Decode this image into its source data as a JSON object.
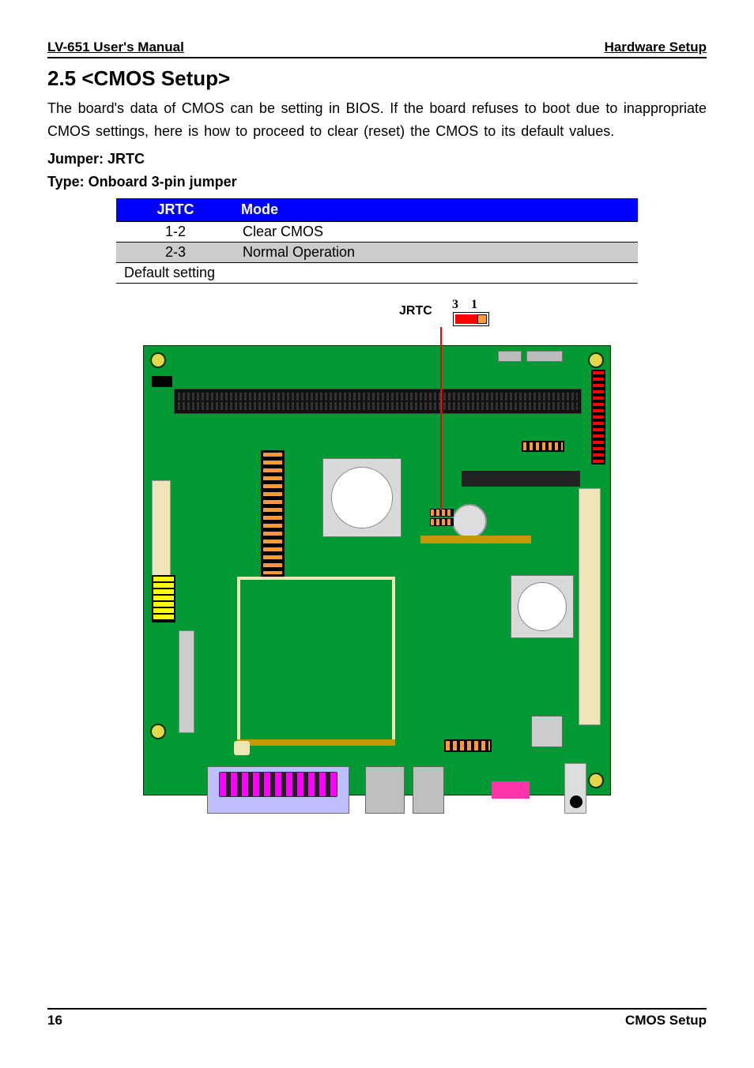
{
  "header": {
    "left": "LV-651 User's Manual",
    "right": "Hardware Setup"
  },
  "section": {
    "title": "2.5 <CMOS Setup>",
    "body": "The board's data of CMOS can be setting in BIOS. If the board refuses to boot due to inappropriate CMOS settings, here is how to proceed to clear (reset) the CMOS to its default values.",
    "jumper_label": "Jumper: JRTC",
    "type_label": "Type: Onboard 3-pin jumper"
  },
  "table": {
    "headers": {
      "col1": "JRTC",
      "col2": "Mode"
    },
    "rows": [
      {
        "col1": "1-2",
        "col2": "Clear CMOS",
        "highlight": false
      },
      {
        "col1": "2-3",
        "col2": "Normal Operation",
        "highlight": true
      }
    ],
    "footer": "Default setting"
  },
  "diagram": {
    "callout_label": "JRTC",
    "pin3": "3",
    "pin1": "1"
  },
  "footer": {
    "page": "16",
    "section": "CMOS  Setup"
  }
}
